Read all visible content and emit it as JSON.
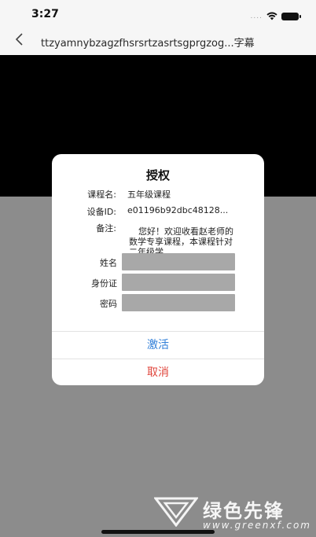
{
  "status_bar": {
    "time": "3:27",
    "signal": "....",
    "wifi_icon": "wifi-icon",
    "battery_icon": "battery-icon"
  },
  "nav": {
    "back_icon": "chevron-left-icon",
    "title": "ttzyamnybzagzfhsrsrtzasrtsgprgzog...字幕"
  },
  "dialog": {
    "title": "授权",
    "course_label": "课程名:",
    "course_value": "五年级课程",
    "device_label": "设备ID:",
    "device_value": "e01196b92dbc48128...",
    "note_label": "备注:",
    "note_value": "您好！欢迎收看赵老师的数学专享课程，本课程针对二年级学",
    "form": {
      "name_label": "姓名",
      "name_value": "",
      "id_label": "身份证",
      "id_value": "",
      "password_label": "密码",
      "password_value": ""
    },
    "activate_label": "激活",
    "cancel_label": "取消"
  },
  "watermark": {
    "brand": "绿色先锋",
    "url": "www.greenxf.com"
  },
  "colors": {
    "activate": "#2f7ed8",
    "cancel": "#e0463c",
    "input_bg": "#a8a8a8",
    "video_bg": "#000000"
  }
}
